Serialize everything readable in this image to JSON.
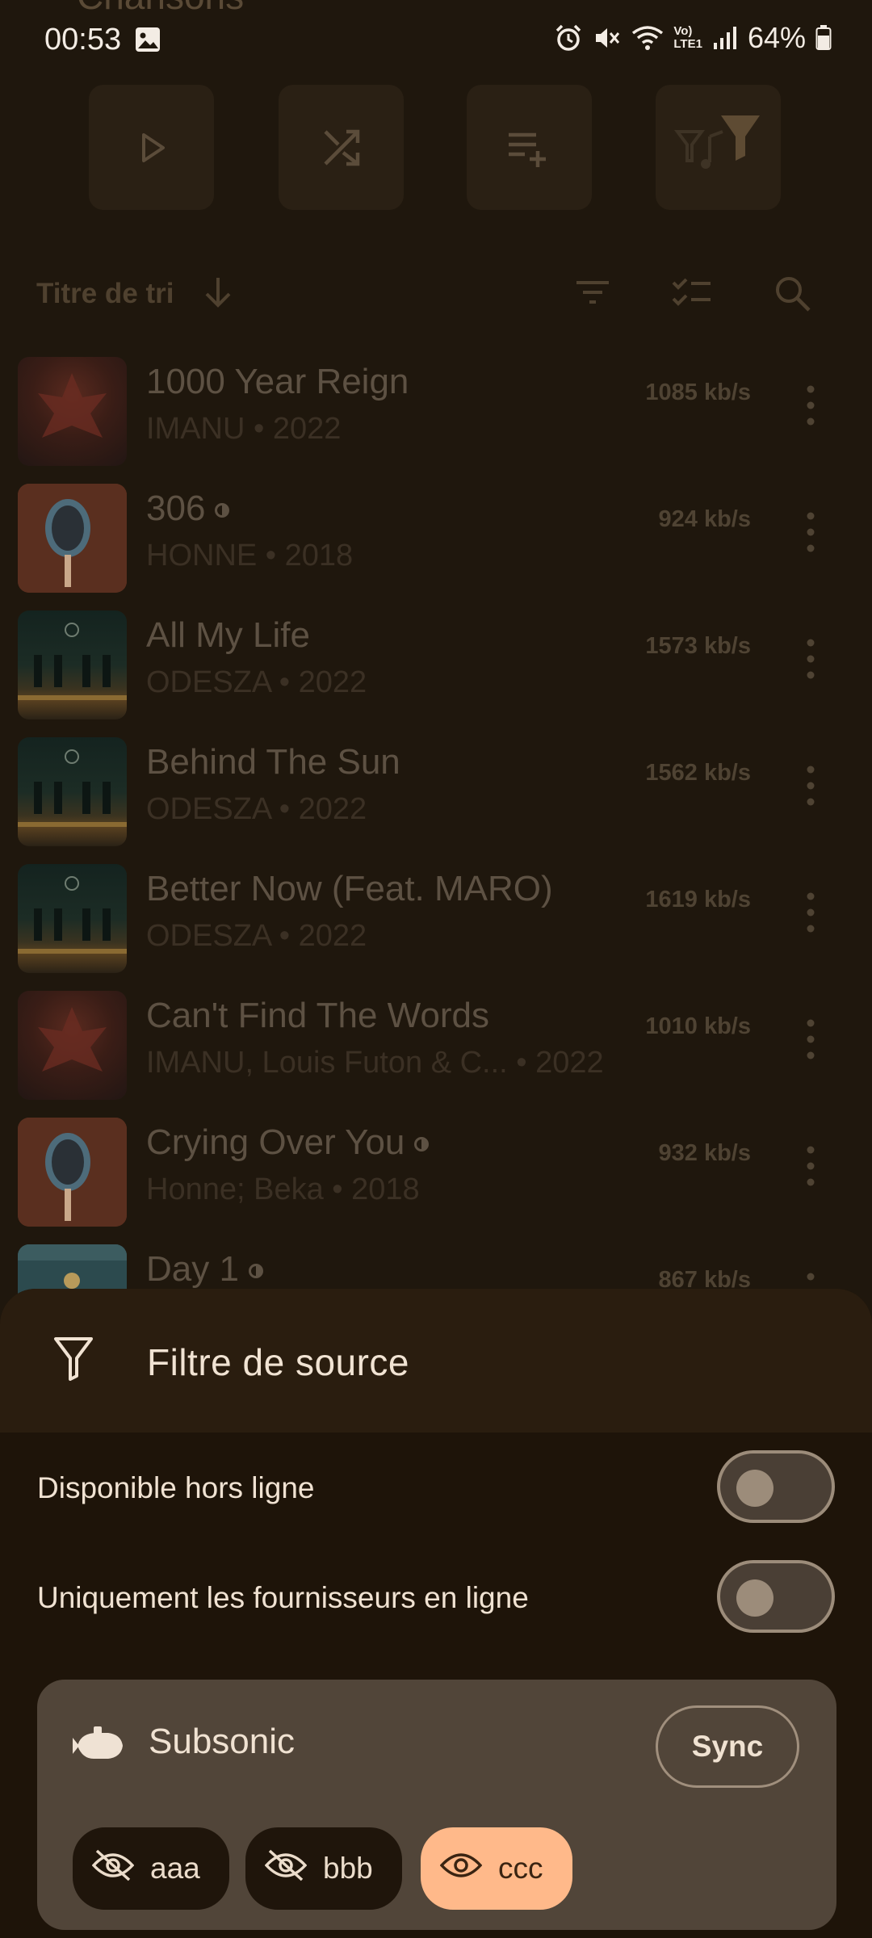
{
  "status_bar": {
    "time": "00:53",
    "battery": "64%",
    "net_top": "Vo)",
    "net_bottom": "LTE1"
  },
  "page": {
    "title_peek": "Chansons"
  },
  "actions": [
    {
      "name": "play-icon"
    },
    {
      "name": "shuffle-icon"
    },
    {
      "name": "add-to-queue-icon"
    },
    {
      "name": "source-filter-icon"
    }
  ],
  "sort": {
    "label": "Titre de tri",
    "direction": "descending"
  },
  "songs": [
    {
      "title": "1000 Year Reign",
      "subtitle": "IMANU • 2022",
      "rate": "1085 kb/s",
      "cover": "destiny",
      "partial": false
    },
    {
      "title": "306",
      "subtitle": "HONNE • 2018",
      "rate": "924 kb/s",
      "cover": "honne",
      "partial": true
    },
    {
      "title": "All My Life",
      "subtitle": "ODESZA • 2022",
      "rate": "1573 kb/s",
      "cover": "odesza",
      "partial": false
    },
    {
      "title": "Behind The Sun",
      "subtitle": "ODESZA • 2022",
      "rate": "1562 kb/s",
      "cover": "odesza",
      "partial": false
    },
    {
      "title": "Better Now (Feat. MARO)",
      "subtitle": "ODESZA • 2022",
      "rate": "1619 kb/s",
      "cover": "odesza",
      "partial": false
    },
    {
      "title": "Can't Find The Words",
      "subtitle": "IMANU, Louis Futon & C... • 2022",
      "rate": "1010 kb/s",
      "cover": "destiny",
      "partial": false
    },
    {
      "title": "Crying Over You",
      "subtitle": "Honne; Beka • 2018",
      "rate": "932 kb/s",
      "cover": "honne",
      "partial": true
    },
    {
      "title": "Day 1",
      "subtitle": "",
      "rate": "867 kb/s",
      "cover": "day1",
      "partial": true
    }
  ],
  "sheet": {
    "title": "Filtre de source",
    "options": [
      {
        "label": "Disponible hors ligne",
        "enabled": false
      },
      {
        "label": "Uniquement les fournisseurs en ligne",
        "enabled": false
      }
    ],
    "provider": {
      "name": "Subsonic",
      "sync_label": "Sync",
      "chips": [
        {
          "label": "aaa",
          "visible": false
        },
        {
          "label": "bbb",
          "visible": false
        },
        {
          "label": "ccc",
          "visible": true
        }
      ]
    }
  },
  "colors": {
    "background": "#1f170d",
    "sheet_header": "#2a1d0f",
    "card": "#514539",
    "accent_chip": "#ffb98a"
  }
}
